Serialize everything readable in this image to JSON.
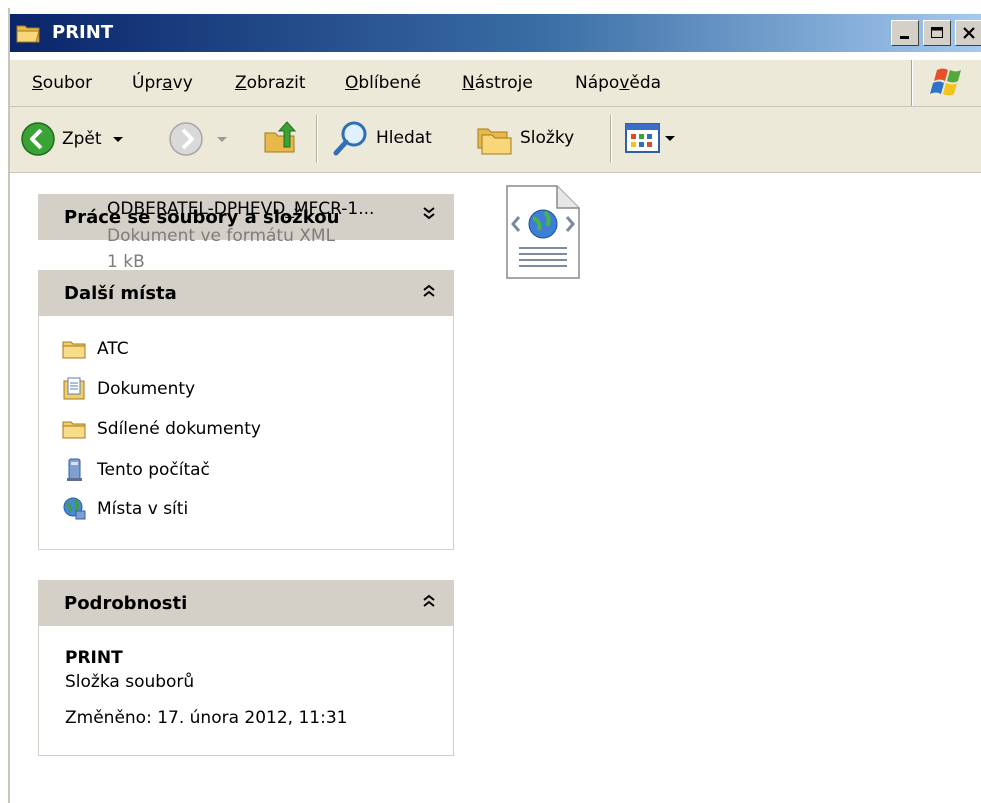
{
  "window": {
    "title": "PRINT"
  },
  "menu": {
    "items": [
      {
        "pre": "",
        "u": "S",
        "post": "oubor"
      },
      {
        "pre": "Úpr",
        "u": "a",
        "post": "vy"
      },
      {
        "pre": "",
        "u": "Z",
        "post": "obrazit"
      },
      {
        "pre": "",
        "u": "O",
        "post": "blíbené"
      },
      {
        "pre": "",
        "u": "N",
        "post": "ástroje"
      },
      {
        "pre": "Nápo",
        "u": "v",
        "post": "ěda"
      }
    ]
  },
  "toolbar": {
    "back_label": "Zpět",
    "search_label": "Hledat",
    "folders_label": "Složky"
  },
  "tasks": {
    "file_tasks_title": "Práce se soubory a složkou",
    "other_places_title": "Další místa",
    "other_places": [
      {
        "label": "ATC",
        "icon": "folder-icon"
      },
      {
        "label": "Dokumenty",
        "icon": "documents-icon"
      },
      {
        "label": "Sdílené dokumenty",
        "icon": "folder-icon"
      },
      {
        "label": "Tento počítač",
        "icon": "computer-icon"
      },
      {
        "label": "Místa v síti",
        "icon": "network-icon"
      }
    ],
    "details_title": "Podrobnosti",
    "details": {
      "name": "PRINT",
      "type": "Složka souborů",
      "modified": "Změněno: 17. února 2012, 11:31"
    }
  },
  "files": [
    {
      "name": "ODBERATEL-DPHEVD_MFCR-1...",
      "type": "Dokument ve formátu XML",
      "size": "1 kB",
      "icon": "xml-document-icon"
    }
  ],
  "colors": {
    "titlebar_start": "#0a246a",
    "titlebar_end": "#a6caf0",
    "chrome": "#ece9d8",
    "pane_header": "#d4d0c8"
  }
}
